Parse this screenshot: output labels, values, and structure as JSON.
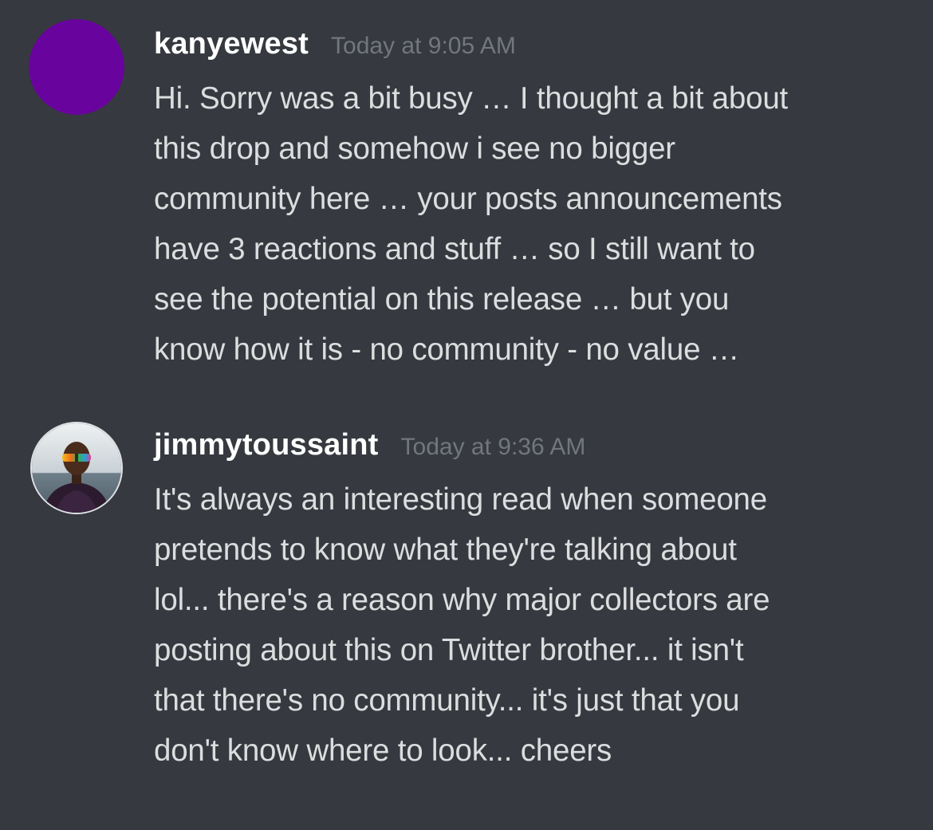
{
  "messages": [
    {
      "username": "kanyewest",
      "timestamp": "Today at 9:05 AM",
      "avatar": {
        "type": "solid",
        "color": "#69039e"
      },
      "text": "Hi. Sorry was a bit busy … I thought a bit about\nthis drop and somehow i see no bigger\ncommunity here … your posts announcements\nhave 3 reactions and stuff … so I still want to\nsee the potential on this release … but you\nknow how it is - no community - no value …"
    },
    {
      "username": "jimmytoussaint",
      "timestamp": "Today at 9:36 AM",
      "avatar": {
        "type": "photo"
      },
      "text": "It's always an interesting read when someone\npretends to know what they're talking about\nlol... there's a reason why major collectors are\nposting about this on Twitter brother... it isn't\nthat there's no community... it's just that you\ndon't know where to look... cheers"
    }
  ],
  "colors": {
    "background": "#36393f",
    "username": "#ffffff",
    "timestamp": "#72767d",
    "message_text": "#dcddde"
  }
}
